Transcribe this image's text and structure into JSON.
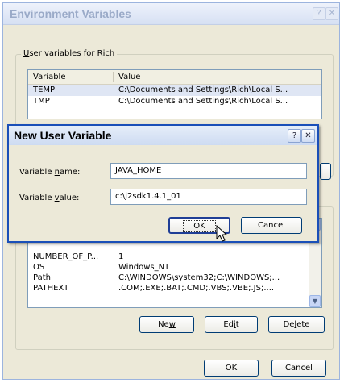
{
  "env_dialog": {
    "title": "Environment Variables",
    "help_button": "?",
    "close_button": "✕",
    "user_group": {
      "label": "User variables for Rich",
      "columns": [
        "Variable",
        "Value"
      ],
      "rows": [
        {
          "variable": "TEMP",
          "value": "C:\\Documents and Settings\\Rich\\Local S..."
        },
        {
          "variable": "TMP",
          "value": "C:\\Documents and Settings\\Rich\\Local S..."
        }
      ]
    },
    "system_list": {
      "rows": [
        {
          "variable": "NUMBER_OF_P...",
          "value": "1"
        },
        {
          "variable": "OS",
          "value": "Windows_NT"
        },
        {
          "variable": "Path",
          "value": "C:\\WINDOWS\\system32;C:\\WINDOWS;..."
        },
        {
          "variable": "PATHEXT",
          "value": ".COM;.EXE;.BAT;.CMD;.VBS;.VBE;.JS;...."
        }
      ]
    },
    "buttons": {
      "new": "New",
      "edit": "Edit",
      "delete": "Delete",
      "ok": "OK",
      "cancel": "Cancel"
    }
  },
  "new_var_dialog": {
    "title": "New User Variable",
    "help_button": "?",
    "close_button": "✕",
    "name_label": "Variable name:",
    "name_value": "JAVA_HOME",
    "value_label": "Variable value:",
    "value_value": "c:\\j2sdk1.4.1_01",
    "ok": "OK",
    "cancel": "Cancel"
  },
  "icons": {
    "cursor": "mouse-pointer-icon",
    "scroll_down": "chevron-down-icon",
    "scroll_up": "chevron-up-icon"
  }
}
